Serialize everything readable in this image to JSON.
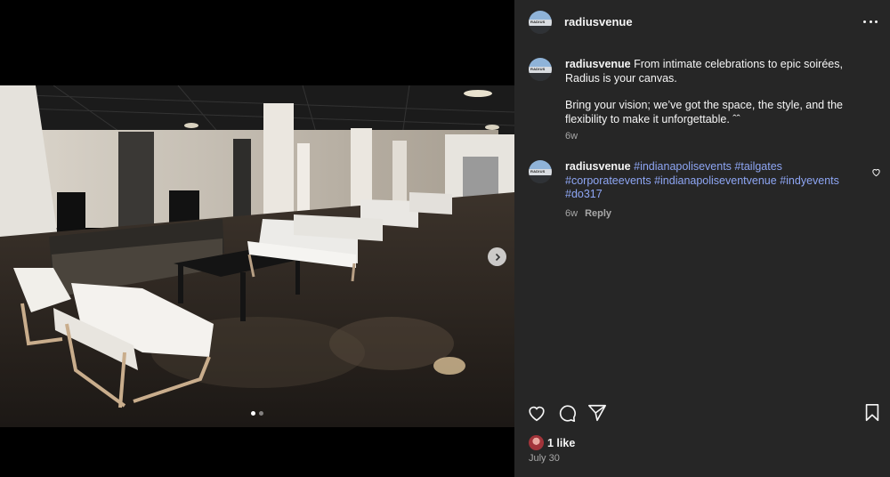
{
  "post": {
    "username": "radiusvenue",
    "avatar_text": "RADIUS",
    "caption": {
      "line1": "From intimate celebrations to epic soirées, Radius is your canvas.",
      "line2": "Bring your vision; we’ve got the space, the style, and the flexibility to make it unforgettable. ˆˆ",
      "time": "6w"
    },
    "comment": {
      "username": "radiusvenue",
      "tags": [
        "#indianapolisevents",
        "#tailgates",
        "#corporateevents",
        "#indianapoliseventvenue",
        "#indyevents",
        "#do317"
      ],
      "time": "6w",
      "reply_label": "Reply"
    },
    "likes": "1 like",
    "date": "July 30"
  },
  "carousel": {
    "count": 2,
    "active": 1
  },
  "icons": {
    "more": "more-horizontal-icon",
    "next": "chevron-right-icon",
    "like": "heart-icon",
    "comment": "comment-icon",
    "share": "paper-plane-icon",
    "save": "bookmark-icon"
  },
  "colors": {
    "panel_bg": "#262626",
    "hashtag": "#8ea6f4",
    "muted": "#a8a8a8"
  }
}
